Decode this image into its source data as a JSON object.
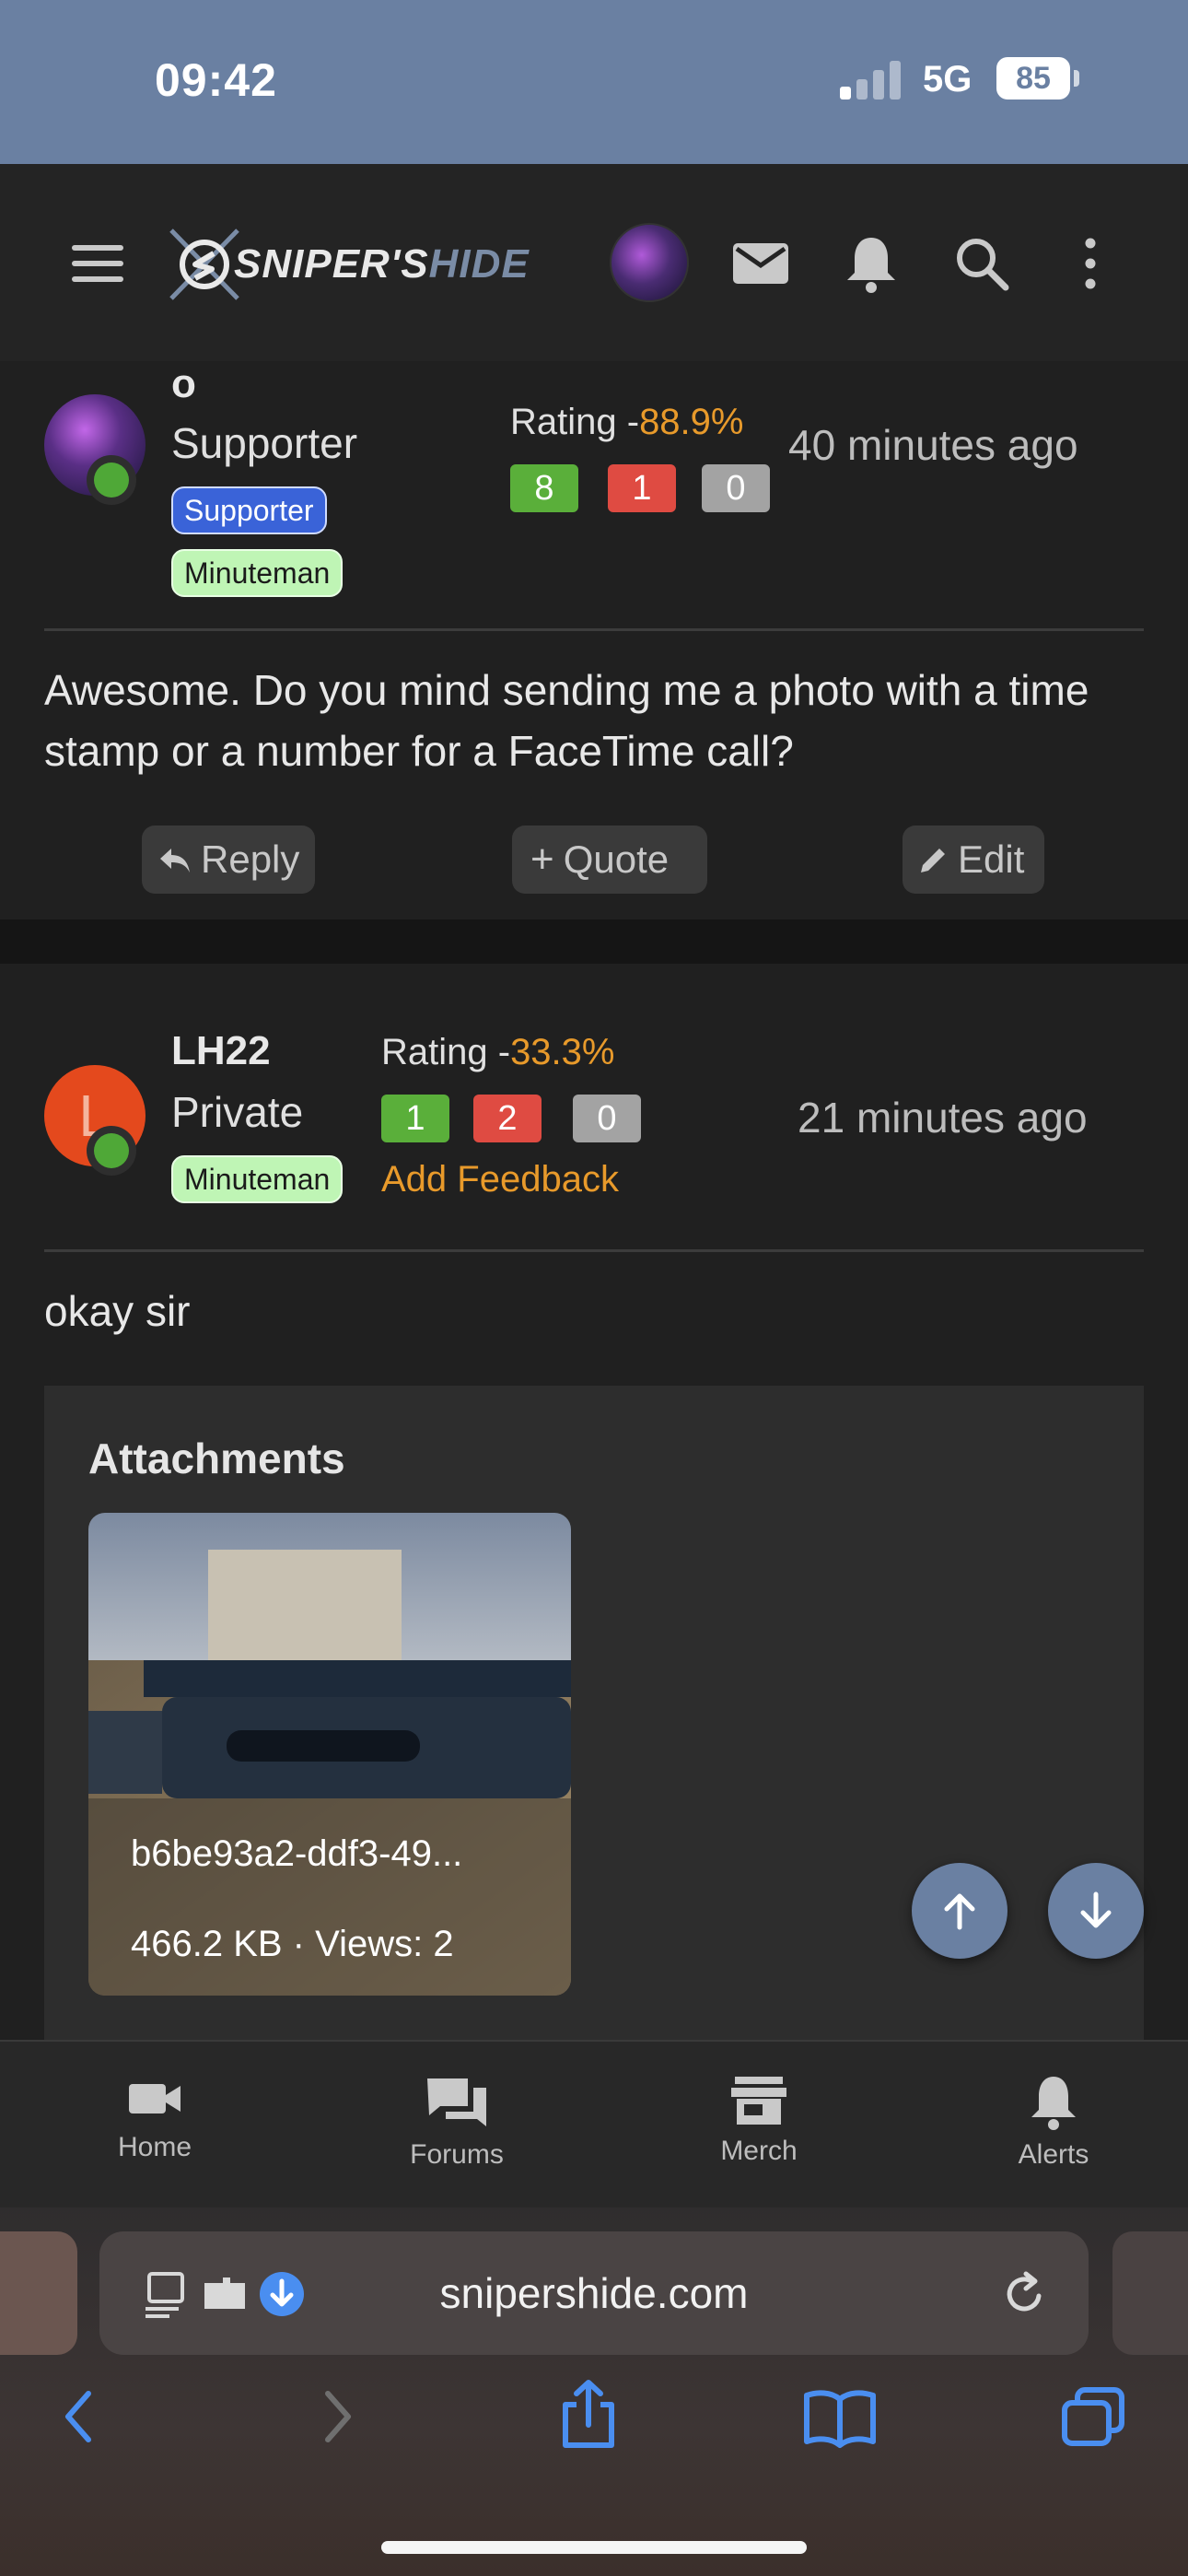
{
  "status_bar": {
    "time": "09:42",
    "network": "5G",
    "battery": "85"
  },
  "header": {
    "logo_main": "SNIPER'S",
    "logo_accent": "HIDE"
  },
  "post1": {
    "username": "o",
    "user_title": "Supporter",
    "badges": [
      "Supporter",
      "Minuteman"
    ],
    "rating_label": "Rating -",
    "rating_pct": "88.9%",
    "scores": {
      "positive": "8",
      "negative": "1",
      "neutral": "0"
    },
    "time": "40 minutes ago",
    "body": "Awesome. Do you mind sending me a photo with a time stamp or a number for a FaceTime call?",
    "actions": {
      "reply": "Reply",
      "quote": "Quote",
      "edit": "Edit"
    }
  },
  "post2": {
    "avatar_letter": "L",
    "username": "LH22",
    "user_title": "Private",
    "badges": [
      "Minuteman"
    ],
    "rating_label": "Rating -",
    "rating_pct": "33.3%",
    "scores": {
      "positive": "1",
      "negative": "2",
      "neutral": "0"
    },
    "add_feedback": "Add Feedback",
    "time": "21 minutes ago",
    "body": "okay sir",
    "attachments": {
      "title": "Attachments",
      "file_name": "b6be93a2-ddf3-49...",
      "file_meta": "466.2 KB · Views: 2"
    }
  },
  "bottom_nav": [
    {
      "label": "Home",
      "icon": "video-camera-icon"
    },
    {
      "label": "Forums",
      "icon": "chat-bubbles-icon"
    },
    {
      "label": "Merch",
      "icon": "store-icon"
    },
    {
      "label": "Alerts",
      "icon": "bell-icon"
    }
  ],
  "browser": {
    "url": "snipershide.com"
  },
  "colors": {
    "status_bar": "#6a80a2",
    "accent_orange": "#e89a2b",
    "positive": "#5aaf3a",
    "negative": "#df4b42",
    "neutral": "#a3a3a3",
    "supporter_badge": "#3a63d8",
    "minuteman_badge": "#bff5b5",
    "safari_blue": "#4a8ef0"
  }
}
